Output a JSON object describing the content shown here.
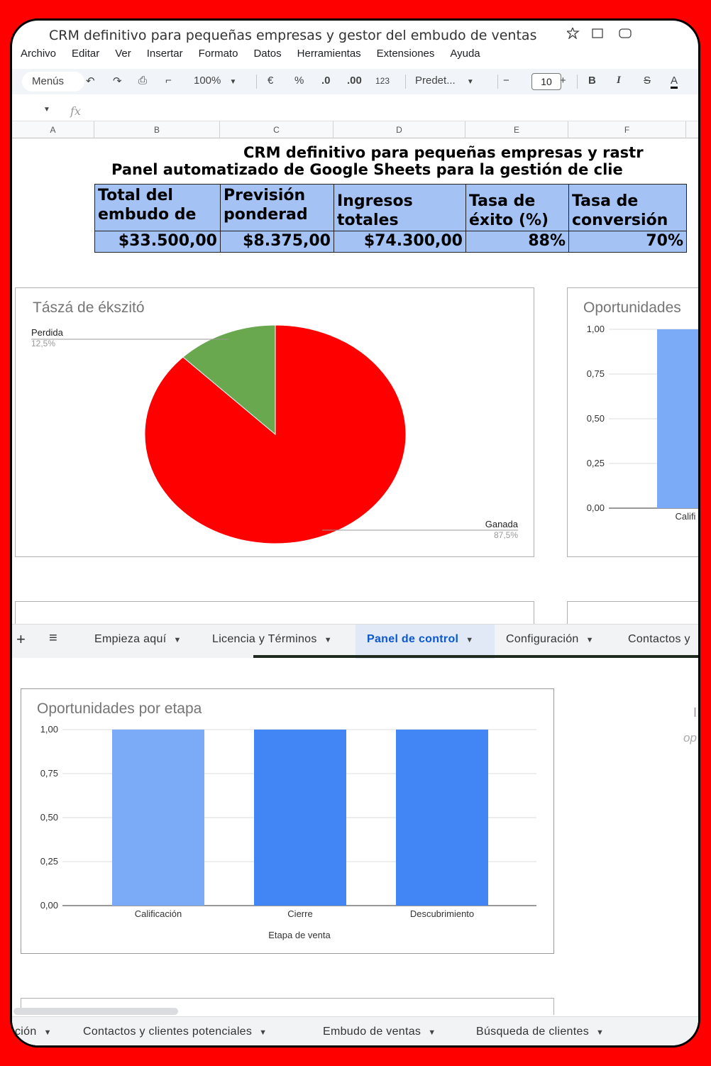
{
  "window": {
    "title_partial": "CRM definitivo para pequeñas empresas y gestor del embudo de ventas"
  },
  "menu": [
    "Archivo",
    "Editar",
    "Ver",
    "Insertar",
    "Formato",
    "Datos",
    "Herramientas",
    "Extensiones",
    "Ayuda"
  ],
  "toolbar": {
    "menus": "Menús",
    "zoom": "100%",
    "currency": "€",
    "percent": "%",
    "dec_less": ".0",
    "dec_more": ".00",
    "number_format": "123",
    "font": "Predet...",
    "font_size": "10",
    "bold": "B",
    "italic": "I",
    "strike": "S",
    "text_color": "A"
  },
  "formula": {
    "fx": "fx"
  },
  "columns": [
    "A",
    "B",
    "C",
    "D",
    "E",
    "F"
  ],
  "sheet": {
    "title": "CRM definitivo para pequeñas empresas y rastr",
    "subtitle": "Panel automatizado de Google Sheets para la gestión de clie"
  },
  "kpis": {
    "headers": [
      "Total del embudo de",
      "Previsión ponderad",
      "Ingresos totales",
      "Tasa de éxito (%)",
      "Tasa de conversión"
    ],
    "values": [
      "$33.500,00",
      "$8.375,00",
      "$74.300,00",
      "88%",
      "70%"
    ]
  },
  "chart_data": [
    {
      "type": "pie",
      "title": "Tászá de ékszitó",
      "slices": [
        {
          "label": "Ganada",
          "value": 87.5,
          "pct_label": "87,5%",
          "color": "#ff0000"
        },
        {
          "label": "Perdida",
          "value": 12.5,
          "pct_label": "12,5%",
          "color": "#6aa84f"
        }
      ]
    },
    {
      "type": "bar",
      "title": "Oportunidades",
      "categories": [
        "Califi"
      ],
      "values": [
        1.0
      ],
      "ylim": [
        0,
        1
      ],
      "yticks": [
        "1,00",
        "0,75",
        "0,50",
        "0,25",
        "0,00"
      ],
      "colors": [
        "#7baaf7"
      ],
      "cropped": true
    },
    {
      "type": "bar",
      "title": "Oportunidades por etapa",
      "categories": [
        "Calificación",
        "Cierre",
        "Descubrimiento"
      ],
      "values": [
        1.0,
        1.0,
        1.0
      ],
      "ylim": [
        0,
        1
      ],
      "yticks": [
        "1,00",
        "0,75",
        "0,50",
        "0,25",
        "0,00"
      ],
      "xlabel": "Etapa de venta",
      "colors": [
        "#7baaf7",
        "#4285f4",
        "#4285f4"
      ]
    }
  ],
  "tabs_top": [
    {
      "label": "Empieza aquí",
      "active": false
    },
    {
      "label": "Licencia y Términos",
      "active": false
    },
    {
      "label": "Panel de control",
      "active": true
    },
    {
      "label": "Configuración",
      "active": false
    },
    {
      "label": "Contactos y",
      "active": false
    }
  ],
  "tabs_bottom": [
    {
      "label": "ción",
      "active": false
    },
    {
      "label": "Contactos y clientes potenciales",
      "active": false
    },
    {
      "label": "Embudo de ventas",
      "active": false
    },
    {
      "label": "Búsqueda de clientes",
      "active": false
    }
  ],
  "side_fragments": [
    "I",
    "op"
  ],
  "colors": {
    "accent": "#0b57d0",
    "kpi_fill": "#a4c2f4",
    "frame": "#ff0000"
  }
}
